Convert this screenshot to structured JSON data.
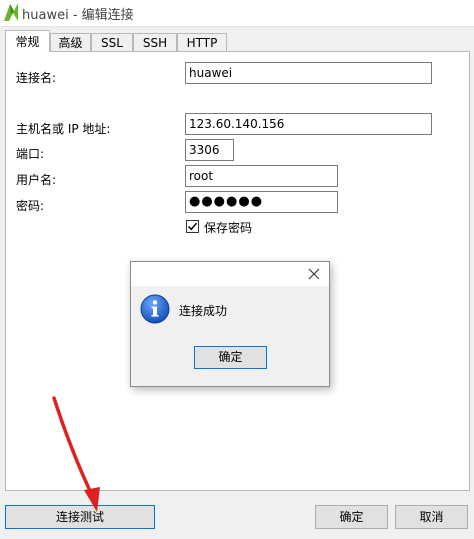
{
  "window": {
    "title": "huawei - 编辑连接",
    "logo_icon": "navicat-logo-icon"
  },
  "tabs": [
    {
      "label": "常规",
      "active": true
    },
    {
      "label": "高级",
      "active": false
    },
    {
      "label": "SSL",
      "active": false
    },
    {
      "label": "SSH",
      "active": false
    },
    {
      "label": "HTTP",
      "active": false
    }
  ],
  "form": {
    "connection_name": {
      "label": "连接名:",
      "value": "huawei"
    },
    "host": {
      "label": "主机名或 IP 地址:",
      "value": "123.60.140.156"
    },
    "port": {
      "label": "端口:",
      "value": "3306"
    },
    "username": {
      "label": "用户名:",
      "value": "root"
    },
    "password": {
      "label": "密码:",
      "value": "●●●●●●"
    },
    "save_password": {
      "label": "保存密码",
      "checked": true
    }
  },
  "dialog": {
    "message": "连接成功",
    "ok_label": "确定",
    "icon": "info-icon"
  },
  "buttons": {
    "test_connection": "连接测试",
    "ok": "确定",
    "cancel": "取消"
  },
  "colors": {
    "accent": "#0078d7",
    "arrow": "#e02020",
    "logo_green": "#6fb52c"
  }
}
